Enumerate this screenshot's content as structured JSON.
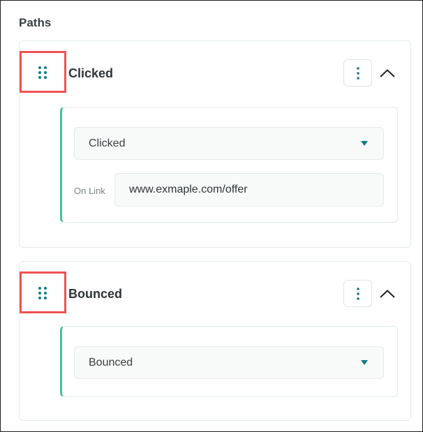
{
  "section": {
    "title": "Paths"
  },
  "paths": [
    {
      "title": "Clicked",
      "event_select": {
        "value": "Clicked"
      },
      "link": {
        "label": "On Link",
        "value": "www.exmaple.com/offer"
      }
    },
    {
      "title": "Bounced",
      "event_select": {
        "value": "Bounced"
      }
    }
  ],
  "icons": {
    "drag": "drag-handle-icon",
    "menu": "vertical-dots-icon",
    "collapse": "chevron-up-icon",
    "dropdown": "caret-down-icon"
  },
  "colors": {
    "accent": "#127a86",
    "panel_border_accent": "#3fc493",
    "highlight": "#f05252"
  }
}
